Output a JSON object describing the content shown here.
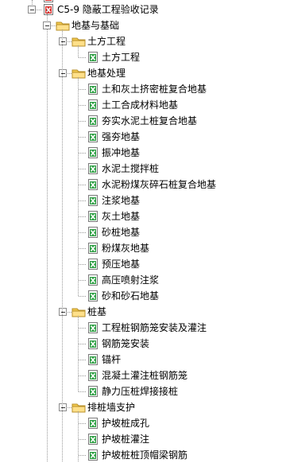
{
  "tree": {
    "root": {
      "label": "C5-9 隐蔽工程验收记录"
    },
    "groups": [
      {
        "label": "地基与基础",
        "children": [
          {
            "label": "土方工程",
            "items": [
              "土方工程"
            ]
          },
          {
            "label": "地基处理",
            "items": [
              "土和灰土挤密桩复合地基",
              "土工合成材料地基",
              "夯实水泥土桩复合地基",
              "强夯地基",
              "振冲地基",
              "水泥土搅拌桩",
              "水泥粉煤灰碎石桩复合地基",
              "注浆地基",
              "灰土地基",
              "砂桩地基",
              "粉煤灰地基",
              "预压地基",
              "高压喷射注浆",
              "砂和砂石地基"
            ]
          },
          {
            "label": "桩基",
            "items": [
              "工程桩钢筋笼安装及灌注",
              "钢筋笼安装",
              "锚杆",
              "混凝土灌注桩钢筋笼",
              "静力压桩焊接接桩"
            ]
          },
          {
            "label": "排桩墙支护",
            "items": [
              "护坡桩成孔",
              "护坡桩灌注",
              "护坡桩桩顶帽梁钢筋"
            ]
          }
        ]
      }
    ]
  },
  "colors": {
    "folder": "#f2c94c",
    "excel": "#2e9e44",
    "pdf": "#d9302c"
  }
}
